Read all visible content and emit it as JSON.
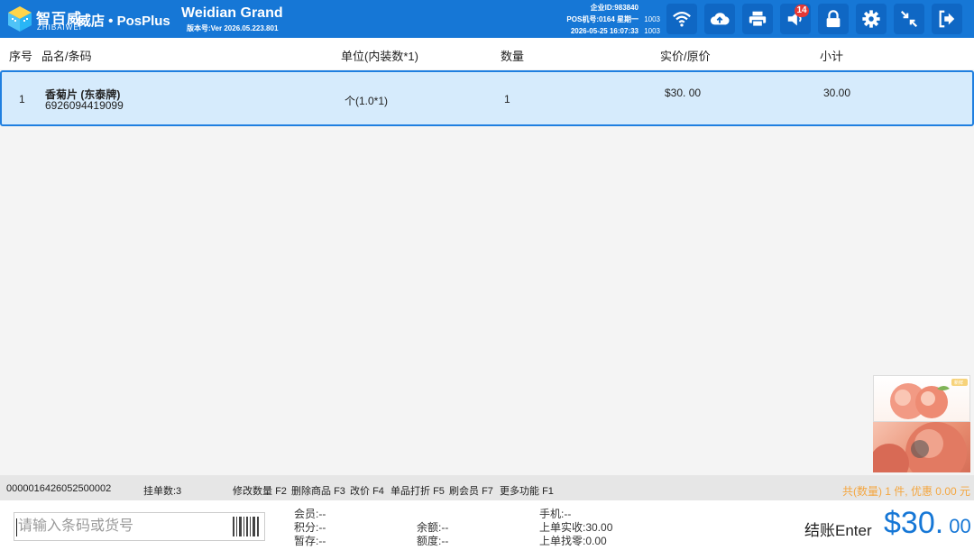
{
  "header": {
    "logo_cn": "智百威",
    "logo_en": "ZHIBAIWEI",
    "brand": "威店 • PosPlus",
    "store_name": "Weidian Grand",
    "version": "版本号:Ver 2026.05.223.801",
    "company_id": "企业ID:983840",
    "pos_info": "POS机号:0164 星期一",
    "datetime": "2026-05-25 16:07:33",
    "operator_1": "1003",
    "operator_2": "1003",
    "notification_count": "14",
    "icons": [
      "wifi-icon",
      "cloud-upload-icon",
      "printer-icon",
      "speaker-icon",
      "lock-icon",
      "gear-icon",
      "shrink-icon",
      "logout-icon"
    ]
  },
  "table": {
    "headers": [
      "序号",
      "品名/条码",
      "单位(内装数*1)",
      "数量",
      "实价/原价",
      "小计"
    ],
    "rows": [
      {
        "index": "1",
        "name": "香菊片 (东泰牌)",
        "barcode": "6926094419099",
        "unit": "个(1.0*1)",
        "qty": "1",
        "price": "$30. 00",
        "subtotal": "30.00"
      }
    ]
  },
  "thumbs": {
    "tag": "新鲜"
  },
  "status": {
    "order_no": "0000016426052500002",
    "hold_count": "挂单数:3",
    "shortcuts": [
      {
        "label": "修改数量",
        "key": "F2"
      },
      {
        "label": "删除商品",
        "key": "F3"
      },
      {
        "label": "改价",
        "key": "F4"
      },
      {
        "label": "单品打折",
        "key": "F5"
      },
      {
        "label": "刷会员",
        "key": "F7"
      },
      {
        "label": "更多功能",
        "key": "F1"
      }
    ],
    "summary": "共(数量) 1 件, 优惠 0.00 元"
  },
  "bottom": {
    "search_placeholder": "请输入条码或货号",
    "member": "会员:--",
    "points": "积分:--",
    "stored": "暂存:--",
    "balance": "余额:--",
    "credit": "额度:--",
    "phone": "手机:--",
    "last_paid": "上单实收:30.00",
    "last_change": "上单找零:0.00",
    "checkout_label": "结账Enter",
    "total_main": "$30.",
    "total_cents": " 00",
    "colors": {
      "primary": "#1677d6",
      "accent": "#f4a640",
      "row_highlight": "#d6ebfc"
    }
  }
}
